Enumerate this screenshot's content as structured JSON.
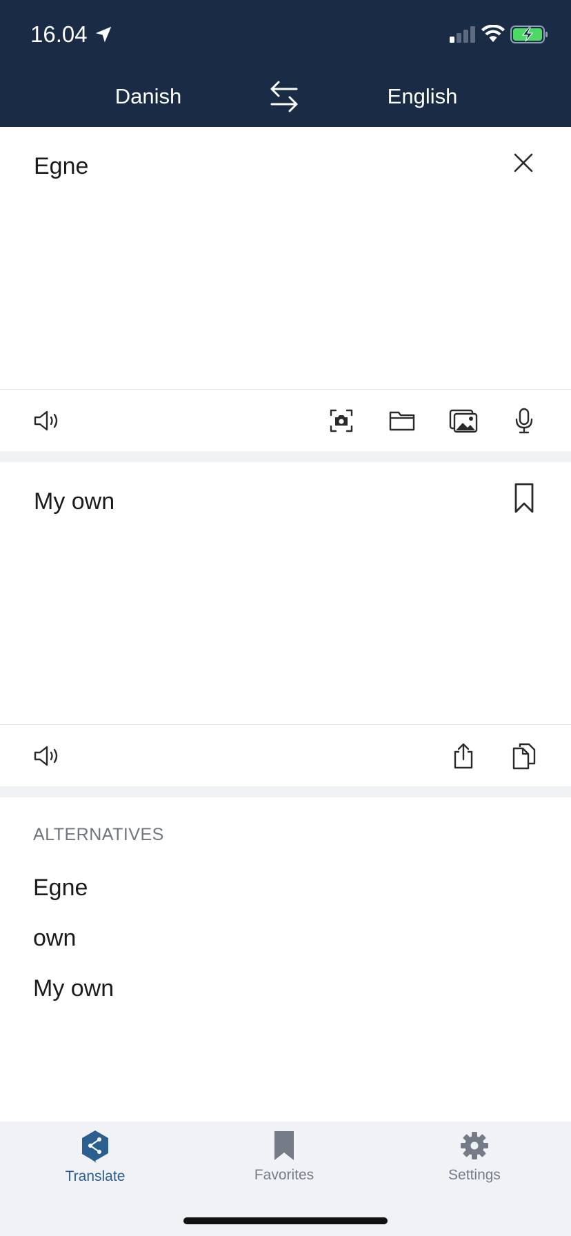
{
  "status_bar": {
    "time": "16.04",
    "icons": [
      "location-arrow-icon",
      "cellular-signal-icon",
      "wifi-icon",
      "battery-charging-icon"
    ],
    "battery_color": "#4cd964"
  },
  "header": {
    "source_language": "Danish",
    "target_language": "English",
    "swap_icon": "swap-arrows-icon",
    "background": "#1a2b45"
  },
  "input_panel": {
    "text": "Egne",
    "icons": [
      "close-icon",
      "speaker-icon",
      "camera-scan-icon",
      "folder-icon",
      "photos-icon",
      "microphone-icon"
    ]
  },
  "output_panel": {
    "text": "My own",
    "icons": [
      "bookmark-icon",
      "speaker-icon",
      "share-icon",
      "copy-icon"
    ]
  },
  "alternatives": {
    "heading": "ALTERNATIVES",
    "items": [
      "Egne",
      "own",
      "My own"
    ]
  },
  "tab_bar": {
    "tabs": [
      {
        "label": "Translate",
        "icon": "deepl-logo-icon",
        "active": true
      },
      {
        "label": "Favorites",
        "icon": "bookmark-icon",
        "active": false
      },
      {
        "label": "Settings",
        "icon": "gear-icon",
        "active": false
      }
    ],
    "active_color": "#2a5f8f",
    "inactive_color": "#767c87"
  }
}
